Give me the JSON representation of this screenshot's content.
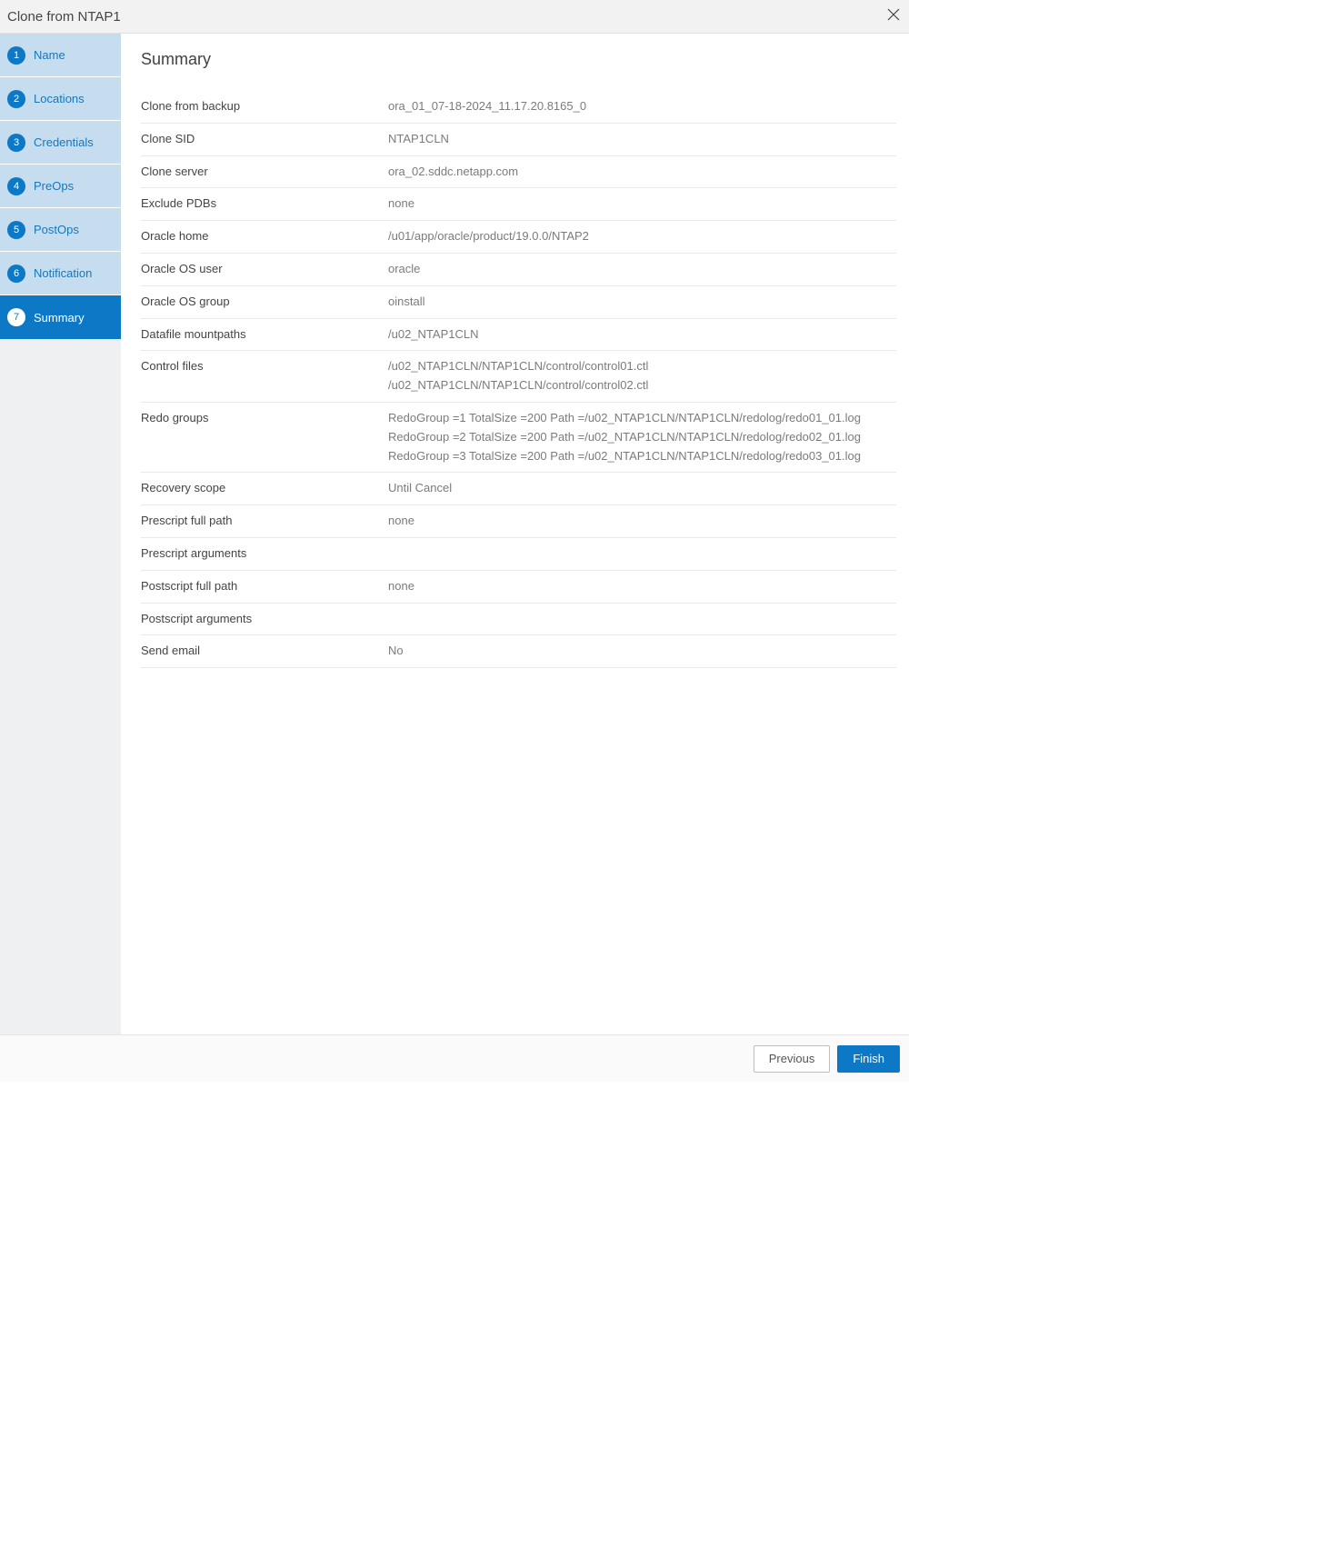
{
  "header": {
    "title": "Clone from NTAP1"
  },
  "sidebar": {
    "steps": [
      {
        "num": "1",
        "label": "Name"
      },
      {
        "num": "2",
        "label": "Locations"
      },
      {
        "num": "3",
        "label": "Credentials"
      },
      {
        "num": "4",
        "label": "PreOps"
      },
      {
        "num": "5",
        "label": "PostOps"
      },
      {
        "num": "6",
        "label": "Notification"
      },
      {
        "num": "7",
        "label": "Summary"
      }
    ]
  },
  "main": {
    "title": "Summary",
    "rows": [
      {
        "key": "Clone from backup",
        "value": "ora_01_07-18-2024_11.17.20.8165_0"
      },
      {
        "key": "Clone SID",
        "value": "NTAP1CLN"
      },
      {
        "key": "Clone server",
        "value": "ora_02.sddc.netapp.com"
      },
      {
        "key": "Exclude PDBs",
        "value": "none"
      },
      {
        "key": "Oracle home",
        "value": "/u01/app/oracle/product/19.0.0/NTAP2"
      },
      {
        "key": "Oracle OS user",
        "value": "oracle"
      },
      {
        "key": "Oracle OS group",
        "value": "oinstall"
      },
      {
        "key": "Datafile mountpaths",
        "value": "/u02_NTAP1CLN"
      },
      {
        "key": "Control files",
        "value": "/u02_NTAP1CLN/NTAP1CLN/control/control01.ctl\n/u02_NTAP1CLN/NTAP1CLN/control/control02.ctl"
      },
      {
        "key": "Redo groups",
        "value": "RedoGroup =1 TotalSize =200 Path =/u02_NTAP1CLN/NTAP1CLN/redolog/redo01_01.log\nRedoGroup =2 TotalSize =200 Path =/u02_NTAP1CLN/NTAP1CLN/redolog/redo02_01.log\nRedoGroup =3 TotalSize =200 Path =/u02_NTAP1CLN/NTAP1CLN/redolog/redo03_01.log"
      },
      {
        "key": "Recovery scope",
        "value": "Until Cancel"
      },
      {
        "key": "Prescript full path",
        "value": "none"
      },
      {
        "key": "Prescript arguments",
        "value": ""
      },
      {
        "key": "Postscript full path",
        "value": "none"
      },
      {
        "key": "Postscript arguments",
        "value": ""
      },
      {
        "key": "Send email",
        "value": "No"
      }
    ]
  },
  "footer": {
    "previous": "Previous",
    "finish": "Finish"
  }
}
